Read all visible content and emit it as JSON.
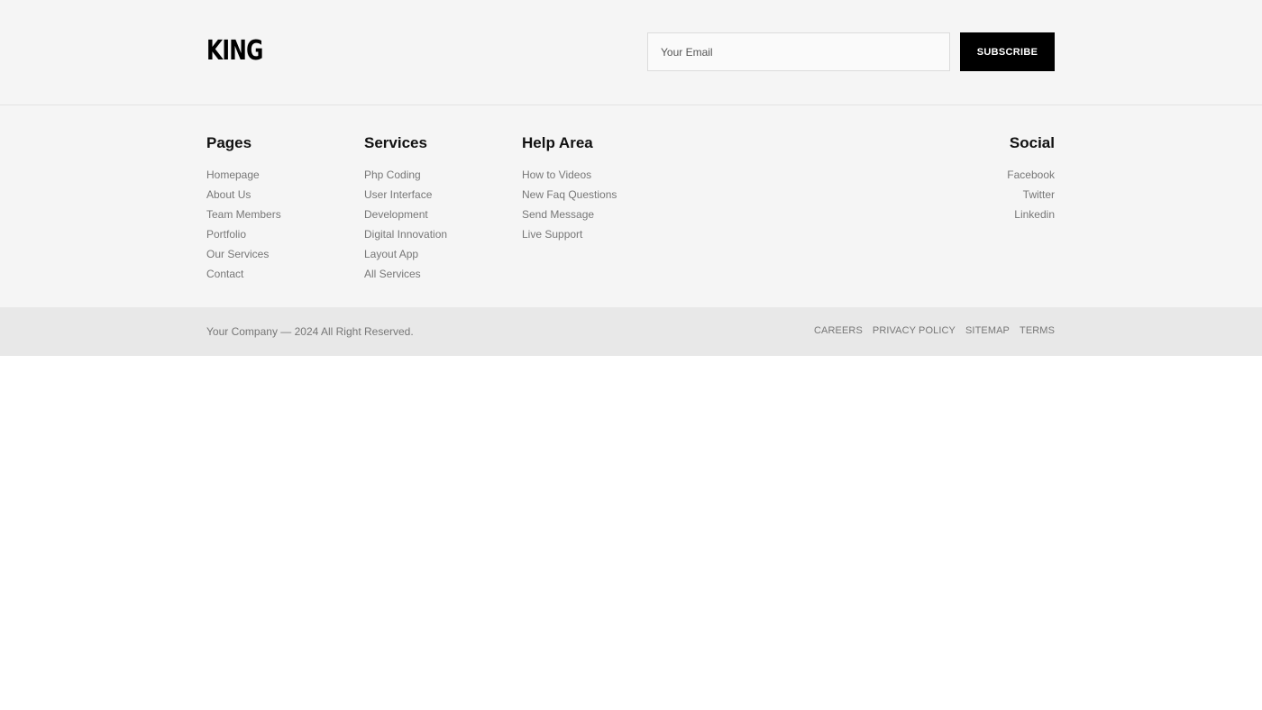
{
  "brand": {
    "logo_text": "KING"
  },
  "newsletter": {
    "email_placeholder": "Your Email",
    "subscribe_label": "SUBSCRIBE"
  },
  "columns": {
    "pages": {
      "title": "Pages",
      "items": [
        "Homepage",
        "About Us",
        "Team Members",
        "Portfolio",
        "Our Services",
        "Contact"
      ]
    },
    "services": {
      "title": "Services",
      "items": [
        "Php Coding",
        "User Interface",
        "Development",
        "Digital Innovation",
        "Layout App",
        "All Services"
      ]
    },
    "help": {
      "title": "Help Area",
      "items": [
        "How to Videos",
        "New Faq Questions",
        "Send Message",
        "Live Support"
      ]
    },
    "social": {
      "title": "Social",
      "items": [
        "Facebook",
        "Twitter",
        "Linkedin"
      ]
    }
  },
  "bottom": {
    "copyright": "Your Company — 2024 All Right Reserved.",
    "links": [
      "CAREERS",
      "PRIVACY POLICY",
      "SITEMAP",
      "TERMS"
    ]
  },
  "colors": {
    "footer_bg": "#f5f5f5",
    "bottom_bar_bg": "#e8e8e8",
    "button_bg": "#000000",
    "link_text": "#777777"
  }
}
